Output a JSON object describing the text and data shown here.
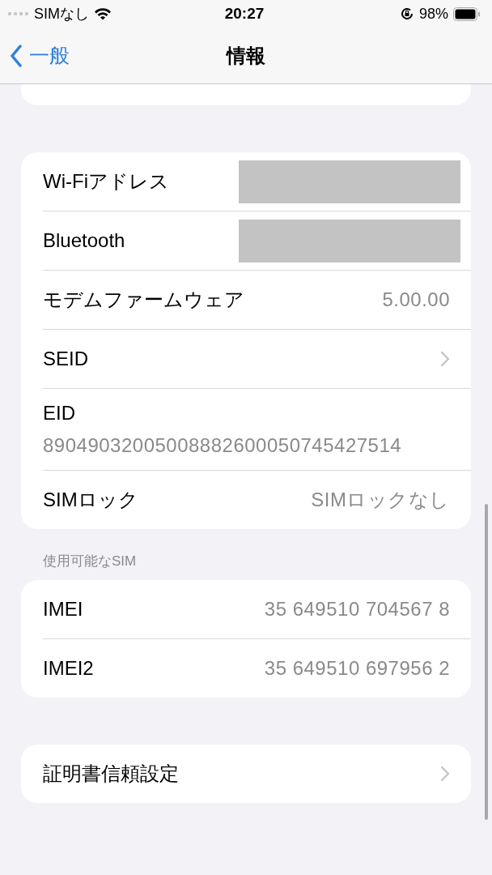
{
  "status_bar": {
    "carrier": "SIMなし",
    "time": "20:27",
    "battery": "98%"
  },
  "nav_bar": {
    "back": "一般",
    "title": "情報"
  },
  "groups": [
    {
      "rows": [
        {
          "kind": "redacted",
          "label": "Wi-Fiアドレス"
        },
        {
          "kind": "redacted",
          "label": "Bluetooth"
        },
        {
          "kind": "value",
          "label": "モデムファームウェア",
          "value": "5.00.00"
        },
        {
          "kind": "link",
          "label": "SEID"
        },
        {
          "kind": "stacked",
          "label": "EID",
          "value": "89049032005008882600050745427514"
        },
        {
          "kind": "value",
          "label": "SIMロック",
          "value": "SIMロックなし"
        }
      ]
    },
    {
      "header": "使用可能なSIM",
      "rows": [
        {
          "kind": "value",
          "label": "IMEI",
          "value": "35 649510 704567 8"
        },
        {
          "kind": "value",
          "label": "IMEI2",
          "value": "35 649510 697956 2"
        }
      ]
    },
    {
      "rows": [
        {
          "kind": "link",
          "label": "証明書信頼設定"
        }
      ]
    }
  ]
}
